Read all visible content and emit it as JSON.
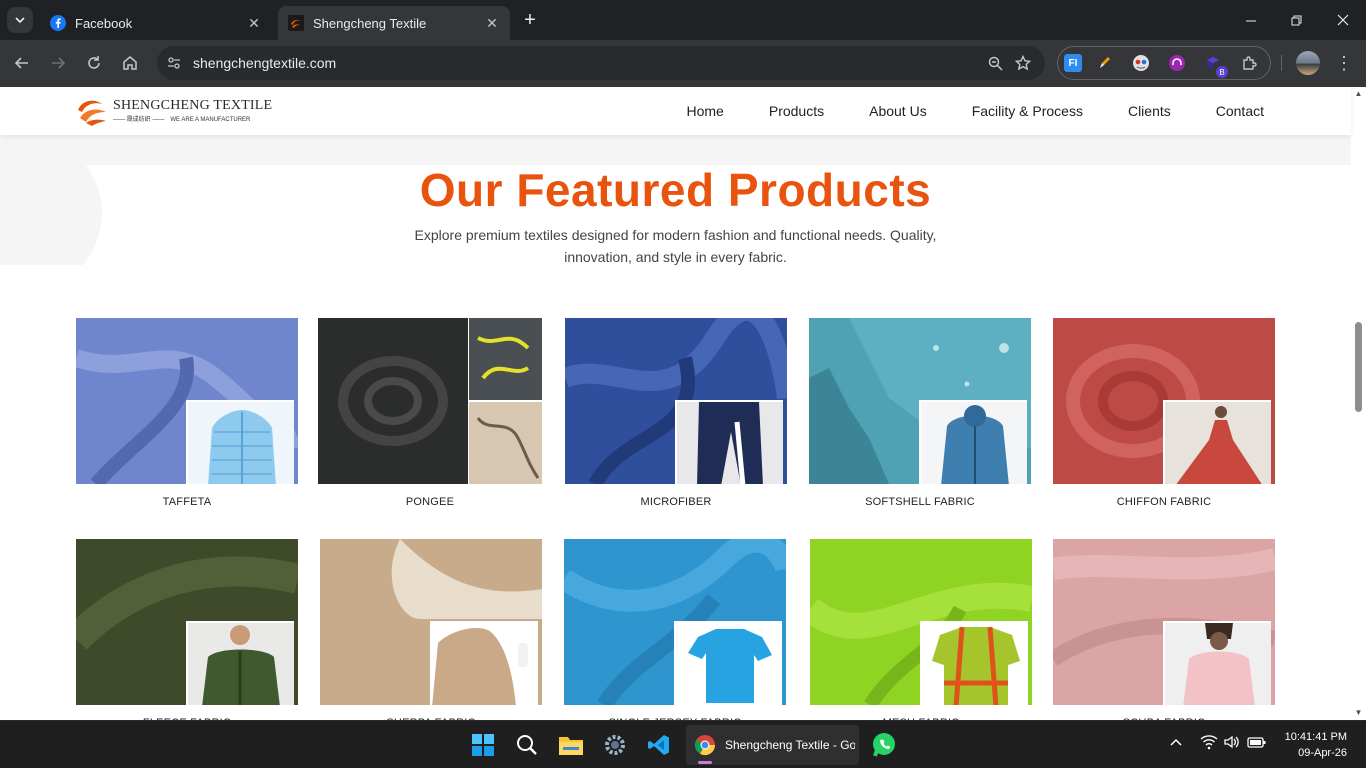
{
  "browser": {
    "tabs": [
      {
        "title": "Facebook",
        "active": false
      },
      {
        "title": "Shengcheng Textile",
        "active": true
      }
    ],
    "url": "shengchengtextile.com"
  },
  "site": {
    "logo": {
      "name": "SHENGCHENG TEXTILE",
      "chinese": "晟成纺织",
      "tagline": "WE ARE A MANUFACTURER"
    },
    "nav": [
      "Home",
      "Products",
      "About Us",
      "Facility & Process",
      "Clients",
      "Contact"
    ],
    "heading": "Our Featured Products",
    "subheading": "Explore premium textiles designed for modern fashion and functional needs. Quality, innovation, and style in every fabric.",
    "products_row1": [
      {
        "name": "TAFFETA",
        "fabric_color": "#6f86cf",
        "product_color": "#8ec9ee"
      },
      {
        "name": "PONGEE",
        "fabric_color": "#2b2d2c",
        "product_color": "#d8c7b0"
      },
      {
        "name": "MICROFIBER",
        "fabric_color": "#2f4e9c",
        "product_color": "#1f2c55"
      },
      {
        "name": "SOFTSHELL FABRIC",
        "fabric_color": "#4fa1b4",
        "product_color": "#3f7fb0"
      },
      {
        "name": "CHIFFON FABRIC",
        "fabric_color": "#bd4a45",
        "product_color": "#c8483d"
      }
    ],
    "products_row2": [
      {
        "name": "FLEECE FABRIC",
        "fabric_color": "#3e4a2a",
        "product_color": "#3f5a2f"
      },
      {
        "name": "SHERPA FABRIC",
        "fabric_color": "#c7ab8a",
        "product_color": "#c9a988"
      },
      {
        "name": "SINGLE JERSEY FABRIC",
        "fabric_color": "#2e95cf",
        "product_color": "#26a3e0"
      },
      {
        "name": "MESH FABRIC",
        "fabric_color": "#8fd323",
        "product_color": "#a6c52c"
      },
      {
        "name": "SCUBA FABRIC",
        "fabric_color": "#dba5a6",
        "product_color": "#f2c2c7"
      }
    ]
  },
  "taskbar": {
    "chrome_label": "Shengcheng Textile - Go",
    "time": "10:41:41 PM",
    "date": "09-Apr-26"
  }
}
